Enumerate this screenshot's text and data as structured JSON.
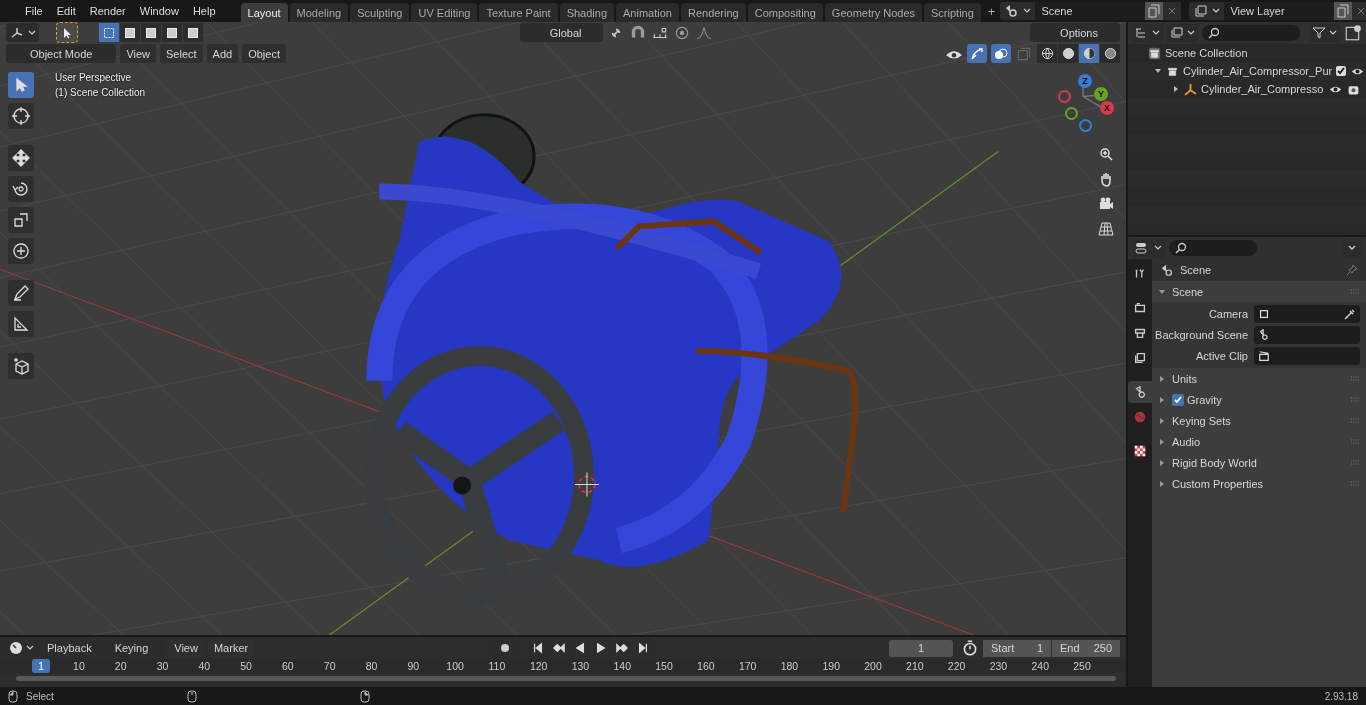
{
  "menu": [
    "File",
    "Edit",
    "Render",
    "Window",
    "Help"
  ],
  "workspaces": [
    {
      "label": "Layout",
      "selected": true
    },
    {
      "label": "Modeling",
      "selected": false
    },
    {
      "label": "Sculpting",
      "selected": false
    },
    {
      "label": "UV Editing",
      "selected": false
    },
    {
      "label": "Texture Paint",
      "selected": false
    },
    {
      "label": "Shading",
      "selected": false
    },
    {
      "label": "Animation",
      "selected": false
    },
    {
      "label": "Rendering",
      "selected": false
    },
    {
      "label": "Compositing",
      "selected": false
    },
    {
      "label": "Geometry Nodes",
      "selected": false
    },
    {
      "label": "Scripting",
      "selected": false
    }
  ],
  "add_workspace": "+",
  "scene": "Scene",
  "view_layer": "View Layer",
  "viewport": {
    "select_modes": [
      {
        "selected": true
      },
      {
        "selected": false
      },
      {
        "selected": false
      },
      {
        "selected": false
      },
      {
        "selected": false
      }
    ],
    "transform_orientation": "Global",
    "options": "Options",
    "mode": "Object Mode",
    "menus": [
      "View",
      "Select",
      "Add",
      "Object"
    ],
    "gizmos_on": true,
    "overlays_on": true,
    "shading": [
      {
        "kind": "wireframe",
        "selected": false
      },
      {
        "kind": "solid",
        "selected": false
      },
      {
        "kind": "material",
        "selected": true
      },
      {
        "kind": "rendered",
        "selected": false
      }
    ],
    "overlay_text": [
      "User Perspective",
      "(1) Scene Collection"
    ],
    "tools": [
      {
        "kind": "select",
        "selected": true
      },
      {
        "kind": "cursor",
        "selected": false
      },
      {
        "kind": "move",
        "selected": false
      },
      {
        "kind": "rotate",
        "selected": false
      },
      {
        "kind": "scale",
        "selected": false
      },
      {
        "kind": "transform",
        "selected": false
      },
      {
        "kind": "annotate",
        "selected": false
      },
      {
        "kind": "measure",
        "selected": false
      },
      {
        "kind": "add-cube",
        "selected": false
      }
    ],
    "gizmo_axes": [
      {
        "label": "Z",
        "color": "#2f7fd6"
      },
      {
        "label": "Y",
        "color": "#6aa31f"
      },
      {
        "label": "X",
        "color": "#d6394d"
      }
    ]
  },
  "outliner": {
    "tree": [
      {
        "label": "Scene Collection",
        "kind": "collection",
        "children": [
          {
            "label": "Cylinder_Air_Compressor_Pur",
            "kind": "collection",
            "expanded": true,
            "checked": true,
            "children": [
              {
                "label": "Cylinder_Air_Compresso",
                "kind": "empty",
                "expanded": false
              }
            ]
          }
        ]
      }
    ]
  },
  "properties": {
    "tabs": [
      {
        "kind": "tool",
        "selected": false
      },
      {
        "kind": "render",
        "selected": false
      },
      {
        "kind": "output",
        "selected": false
      },
      {
        "kind": "view-layer",
        "selected": false
      },
      {
        "kind": "scene",
        "selected": true
      },
      {
        "kind": "world",
        "selected": false
      },
      {
        "kind": "texture",
        "selected": false
      }
    ],
    "context": "Scene",
    "panels": [
      {
        "label": "Scene",
        "expanded": true,
        "fields": [
          {
            "label": "Camera",
            "kind": "camera"
          },
          {
            "label": "Background Scene",
            "kind": "scene"
          },
          {
            "label": "Active Clip",
            "kind": "clip"
          }
        ]
      },
      {
        "label": "Units",
        "expanded": false
      },
      {
        "label": "Gravity",
        "expanded": false,
        "checked": true
      },
      {
        "label": "Keying Sets",
        "expanded": false
      },
      {
        "label": "Audio",
        "expanded": false
      },
      {
        "label": "Rigid Body World",
        "expanded": false
      },
      {
        "label": "Custom Properties",
        "expanded": false
      }
    ]
  },
  "timeline": {
    "menus": [
      "Playback",
      "Keying"
    ],
    "plain_menus": [
      "View",
      "Marker"
    ],
    "current_frame": "1",
    "start_label": "Start",
    "start": "1",
    "end_label": "End",
    "end": "250",
    "ruler_current": "1",
    "ruler": [
      "10",
      "20",
      "30",
      "40",
      "50",
      "60",
      "70",
      "80",
      "90",
      "100",
      "110",
      "120",
      "130",
      "140",
      "150",
      "160",
      "170",
      "180",
      "190",
      "200",
      "210",
      "220",
      "230",
      "240",
      "250"
    ]
  },
  "status_bar": {
    "action": "Select",
    "version": "2.93.18"
  }
}
